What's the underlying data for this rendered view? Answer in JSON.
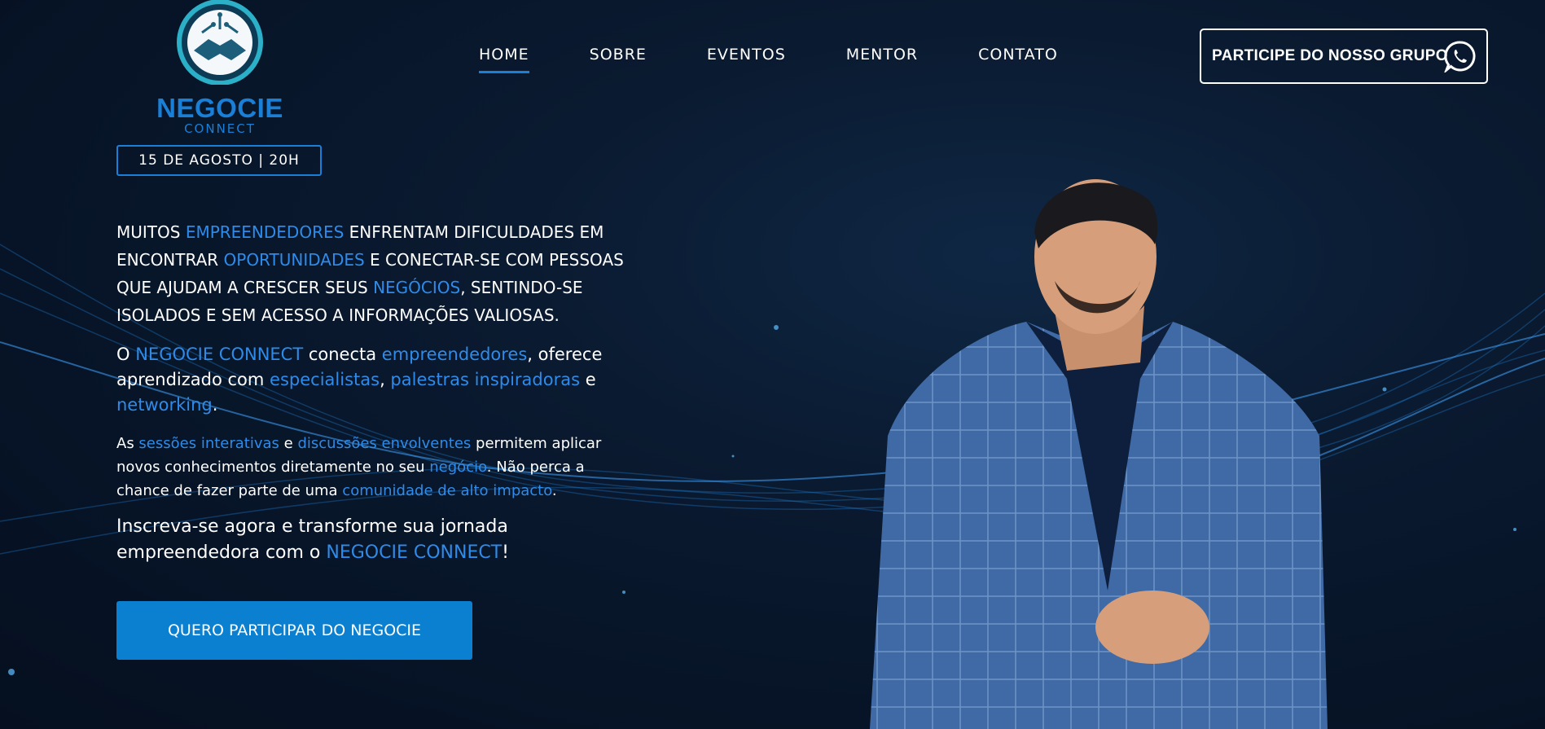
{
  "logo": {
    "name": "NEGOCIE",
    "subtitle": "CONNECT"
  },
  "event_date": "15 DE AGOSTO | 20H",
  "nav": {
    "items": [
      {
        "label": "HOME",
        "active": true
      },
      {
        "label": "SOBRE",
        "active": false
      },
      {
        "label": "EVENTOS",
        "active": false
      },
      {
        "label": "MENTOR",
        "active": false
      },
      {
        "label": "CONTATO",
        "active": false
      }
    ]
  },
  "header_cta": {
    "label": "PARTICIPE DO NOSSO GRUPO",
    "icon": "whatsapp-icon"
  },
  "content": {
    "p1": [
      {
        "t": "MUITOS "
      },
      {
        "t": "EMPREENDEDORES",
        "h": true
      },
      {
        "t": " ENFRENTAM DIFICULDADES EM ENCONTRAR "
      },
      {
        "t": "OPORTUNIDADES",
        "h": true
      },
      {
        "t": " E CONECTAR-SE COM PESSOAS QUE AJUDAM A CRESCER SEUS "
      },
      {
        "t": "NEGÓCIOS",
        "h": true
      },
      {
        "t": ", SENTINDO-SE ISOLADOS E SEM ACESSO A INFORMAÇÕES VALIOSAS."
      }
    ],
    "p2": [
      {
        "t": "O "
      },
      {
        "t": "NEGOCIE CONNECT",
        "h": true
      },
      {
        "t": " conecta "
      },
      {
        "t": "empreendedores",
        "h": true
      },
      {
        "t": ", oferece aprendizado com "
      },
      {
        "t": "especialistas",
        "h": true
      },
      {
        "t": ", "
      },
      {
        "t": "palestras inspiradoras",
        "h": true
      },
      {
        "t": " e "
      },
      {
        "t": "networking",
        "h": true
      },
      {
        "t": "."
      }
    ],
    "p3": [
      {
        "t": "As "
      },
      {
        "t": "sessões interativas",
        "h": true
      },
      {
        "t": " e "
      },
      {
        "t": "discussões envolventes",
        "h": true
      },
      {
        "t": " permitem aplicar novos conhecimentos diretamente no seu "
      },
      {
        "t": "negócio",
        "h": true
      },
      {
        "t": ". Não perca a chance de fazer parte de uma "
      },
      {
        "t": "comunidade de alto impacto",
        "h": true
      },
      {
        "t": "."
      }
    ],
    "p4": [
      {
        "t": "Inscreva-se agora e transforme sua jornada empreendedora com o "
      },
      {
        "t": "NEGOCIE CONNECT",
        "h": true
      },
      {
        "t": "!"
      }
    ]
  },
  "main_button": {
    "label": "QUERO PARTICIPAR DO NEGOCIE"
  },
  "colors": {
    "accent": "#1a7fd6",
    "highlight": "#2e8bea",
    "button": "#0b7fd0",
    "background": "#071427"
  }
}
